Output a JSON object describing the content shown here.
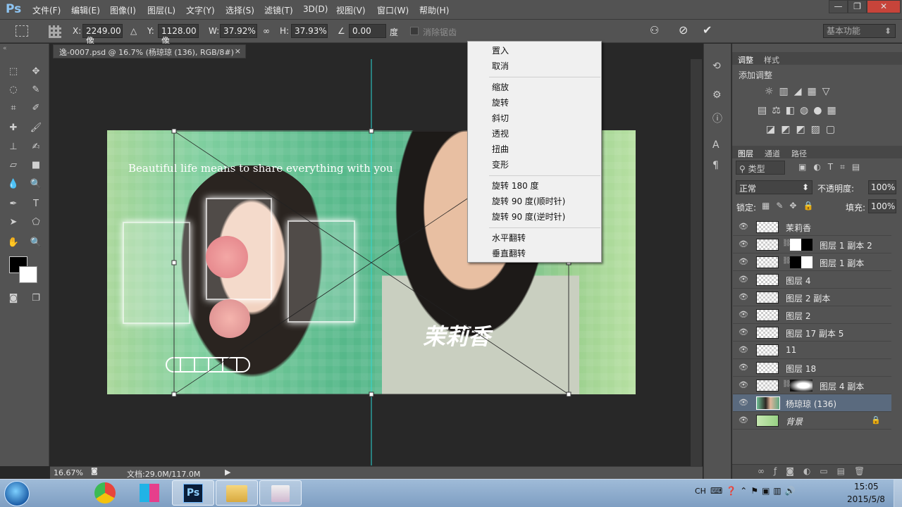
{
  "app": {
    "logo": "Ps"
  },
  "menu": [
    "文件(F)",
    "编辑(E)",
    "图像(I)",
    "图层(L)",
    "文字(Y)",
    "选择(S)",
    "滤镜(T)",
    "3D(D)",
    "视图(V)",
    "窗口(W)",
    "帮助(H)"
  ],
  "window_controls": {
    "minimize": "—",
    "maximize": "❐",
    "close": "✕"
  },
  "options": {
    "x_label": "X:",
    "x_value": "2249.00 像",
    "y_label": "Y:",
    "y_value": "1128.00 像",
    "w_label": "W:",
    "w_value": "37.92%",
    "h_label": "H:",
    "h_value": "37.93%",
    "angle_value": "0.00",
    "angle_unit": "度",
    "antialias_label": "消除锯齿",
    "workspace": "基本功能"
  },
  "document": {
    "tab_title": "逸-0007.psd @ 16.7% (杨琼琼 (136), RGB/8#)",
    "close": "×",
    "image_text": "Beautiful life means to share everything with you",
    "logo_text": "茉莉香"
  },
  "status": {
    "zoom": "16.67%",
    "doc": "文档:29.0M/117.0M"
  },
  "context_menu": {
    "group1": [
      "置入",
      "取消"
    ],
    "group2": [
      "缩放",
      "旋转",
      "斜切",
      "透视",
      "扭曲",
      "变形"
    ],
    "group3": [
      "旋转 180 度",
      "旋转 90 度(顺时针)",
      "旋转 90 度(逆时针)"
    ],
    "group4": [
      "水平翻转",
      "垂直翻转"
    ]
  },
  "adjust_panel": {
    "tab1": "调整",
    "tab2": "样式",
    "title": "添加调整"
  },
  "layers_panel": {
    "tabs": [
      "图层",
      "通道",
      "路径"
    ],
    "filter_kind": "类型",
    "blend_mode": "正常",
    "opacity_label": "不透明度:",
    "opacity_value": "100%",
    "lock_label": "锁定:",
    "fill_label": "填充:",
    "fill_value": "100%",
    "layers": [
      "茉莉香",
      "图层 1 副本 2",
      "图层 1 副本",
      "图层 4",
      "图层 2 副本",
      "图层 2",
      "图层 17 副本 5",
      "11",
      "图层 18",
      "图层 4 副本",
      "杨琼琼 (136)",
      "背景"
    ]
  },
  "taskbar": {
    "lang": "CH",
    "time": "15:05",
    "date": "2015/5/8",
    "ps_label": "Ps"
  }
}
